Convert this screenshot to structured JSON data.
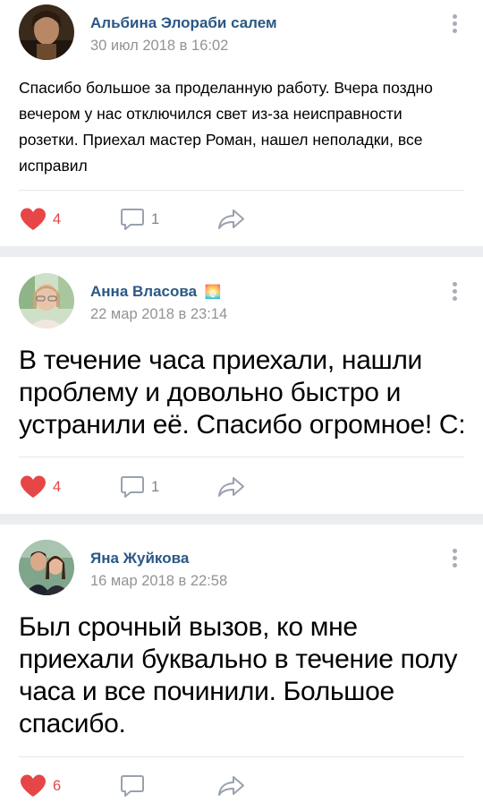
{
  "posts": [
    {
      "author": "Альбина Элораби салем",
      "date": "30 июл 2018 в 16:02",
      "text": "Спасибо большое за проделанную работу. Вчера поздно вечером у нас отключился свет из-за неисправности розетки. Приехал мастер Роман, нашел неполадки, все исправил",
      "likes": "4",
      "comments": "1",
      "liked": true
    },
    {
      "author": "Анна Власова",
      "author_badge": "🌅",
      "date": "22 мар 2018 в 23:14",
      "text": "В течение часа приехали, нашли проблему и довольно быстро и устранили её. Спасибо огромное! С:",
      "likes": "4",
      "comments": "1",
      "liked": true
    },
    {
      "author": "Яна Жуйкова",
      "date": "16 мар 2018 в 22:58",
      "text": "Был срочный вызов,  ко мне приехали буквально в течение полу часа и все починили. Большое спасибо.",
      "likes": "6",
      "comments": "",
      "liked": true
    }
  ],
  "colors": {
    "author": "#2a5885",
    "date": "#939393",
    "like": "#e64646",
    "icon": "#99a2ad",
    "background": "#ebedf0"
  },
  "icons": {
    "like": "heart-icon",
    "comment": "comment-bubble-icon",
    "share": "share-arrow-icon",
    "menu": "more-vertical-icon"
  }
}
